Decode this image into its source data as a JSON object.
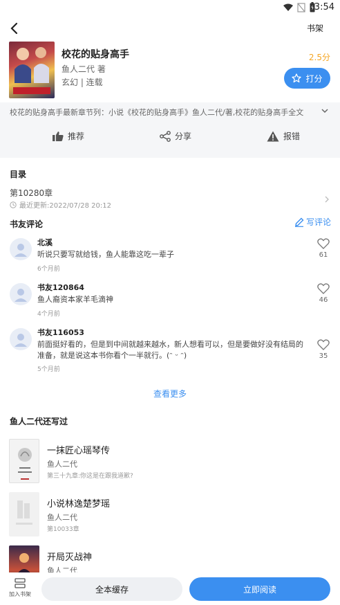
{
  "status_bar": {
    "time": "3:54"
  },
  "header": {
    "shelf_label": "书架"
  },
  "book": {
    "title": "校花的贴身高手",
    "author": "鱼人二代 著",
    "category": "玄幻 | 连载",
    "score": "2.5分",
    "rate_label": "打分",
    "intro": "校花的贴身高手最新章节列：小说《校花的贴身高手》鱼人二代/著,校花的贴身高手全文"
  },
  "actions": {
    "recommend": "推荐",
    "share": "分享",
    "report": "报错"
  },
  "toc": {
    "title": "目录",
    "latest_chapter": "第10280章",
    "updated": "最近更新:2022/07/28 20:12"
  },
  "comments": {
    "title": "书友评论",
    "write_label": "写评论",
    "items": [
      {
        "name": "北溪",
        "text": "听说只要写就给钱，鱼人能靠这吃一辈子",
        "time": "6个月前",
        "likes": "61"
      },
      {
        "name": "书友120864",
        "text": "鱼人裔资本家羊毛滴神",
        "time": "4个月前",
        "likes": "46"
      },
      {
        "name": "书友116053",
        "text": "前面挺好看的，但是到中间就越来越水，新人想看可以，但是要做好没有结局的准备，就是说这本书你看个一半就行。(ᵔ ᵕ ᵔ)",
        "time": "5个月前",
        "likes": "35"
      }
    ],
    "more_label": "查看更多"
  },
  "author_books": {
    "title": "鱼人二代还写过",
    "items": [
      {
        "title": "一抹匠心瑶琴传",
        "author": "鱼人二代",
        "chapter": "第三十九章:你这是在跟我道歉?"
      },
      {
        "title": "小说林逸楚梦瑶",
        "author": "鱼人二代",
        "chapter": "第10033章"
      },
      {
        "title": "开局灭战神",
        "author": "鱼人二代",
        "chapter": ""
      }
    ]
  },
  "bottom": {
    "add_shelf": "加入书架",
    "cache_all": "全本缓存",
    "read_now": "立即阅读"
  },
  "colors": {
    "accent": "#3b8ff0",
    "score": "#f5a623"
  }
}
